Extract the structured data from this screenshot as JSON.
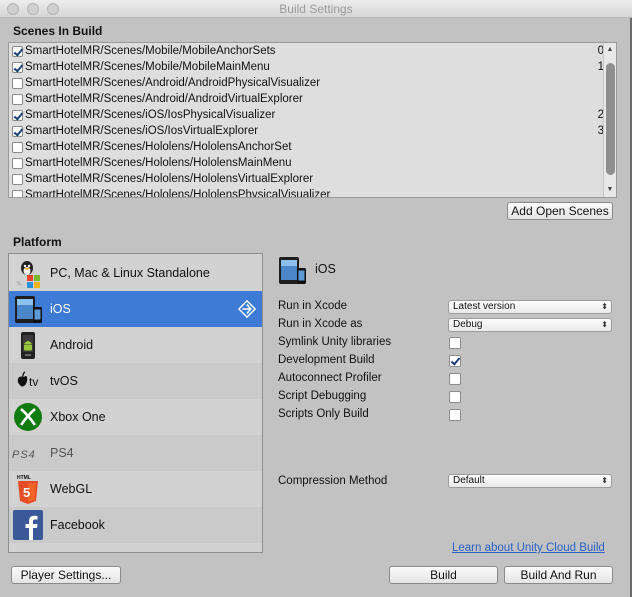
{
  "window": {
    "title": "Build Settings"
  },
  "scenes": {
    "header": "Scenes In Build",
    "rows": [
      {
        "path": "SmartHotelMR/Scenes/Mobile/MobileAnchorSets",
        "checked": true,
        "index": "0"
      },
      {
        "path": "SmartHotelMR/Scenes/Mobile/MobileMainMenu",
        "checked": true,
        "index": "1"
      },
      {
        "path": "SmartHotelMR/Scenes/Android/AndroidPhysicalVisualizer",
        "checked": false,
        "index": ""
      },
      {
        "path": "SmartHotelMR/Scenes/Android/AndroidVirtualExplorer",
        "checked": false,
        "index": ""
      },
      {
        "path": "SmartHotelMR/Scenes/iOS/IosPhysicalVisualizer",
        "checked": true,
        "index": "2"
      },
      {
        "path": "SmartHotelMR/Scenes/iOS/IosVirtualExplorer",
        "checked": true,
        "index": "3"
      },
      {
        "path": "SmartHotelMR/Scenes/Hololens/HololensAnchorSet",
        "checked": false,
        "index": ""
      },
      {
        "path": "SmartHotelMR/Scenes/Hololens/HololensMainMenu",
        "checked": false,
        "index": ""
      },
      {
        "path": "SmartHotelMR/Scenes/Hololens/HololensVirtualExplorer",
        "checked": false,
        "index": ""
      },
      {
        "path": "SmartHotelMR/Scenes/Hololens/HololensPhysicalVisualizer",
        "checked": false,
        "index": ""
      }
    ],
    "add_open_scenes": "Add Open Scenes"
  },
  "platform": {
    "header": "Platform",
    "items": [
      {
        "label": "PC, Mac & Linux Standalone",
        "icon": "pc-mac-linux-icon"
      },
      {
        "label": "iOS",
        "icon": "ios-device-icon",
        "selected": true
      },
      {
        "label": "Android",
        "icon": "android-icon"
      },
      {
        "label": "tvOS",
        "icon": "apple-tv-icon"
      },
      {
        "label": "Xbox One",
        "icon": "xbox-icon"
      },
      {
        "label": "PS4",
        "icon": "ps4-icon"
      },
      {
        "label": "WebGL",
        "icon": "html5-icon"
      },
      {
        "label": "Facebook",
        "icon": "facebook-icon"
      }
    ]
  },
  "settings": {
    "platform_title": "iOS",
    "run_in_xcode": {
      "label": "Run in Xcode",
      "value": "Latest version"
    },
    "run_in_xcode_as": {
      "label": "Run in Xcode as",
      "value": "Debug"
    },
    "symlink": {
      "label": "Symlink Unity libraries",
      "checked": false
    },
    "development_build": {
      "label": "Development Build",
      "checked": true
    },
    "autoconnect_profiler": {
      "label": "Autoconnect Profiler",
      "checked": false
    },
    "script_debugging": {
      "label": "Script Debugging",
      "checked": false
    },
    "scripts_only": {
      "label": "Scripts Only Build",
      "checked": false
    },
    "compression": {
      "label": "Compression Method",
      "value": "Default"
    },
    "cloud_link": "Learn about Unity Cloud Build"
  },
  "footer": {
    "player_settings": "Player Settings...",
    "build": "Build",
    "build_and_run": "Build And Run"
  },
  "colors": {
    "selection": "#3d7bd6",
    "link": "#2a62c8",
    "panel": "#c2c2c2"
  }
}
